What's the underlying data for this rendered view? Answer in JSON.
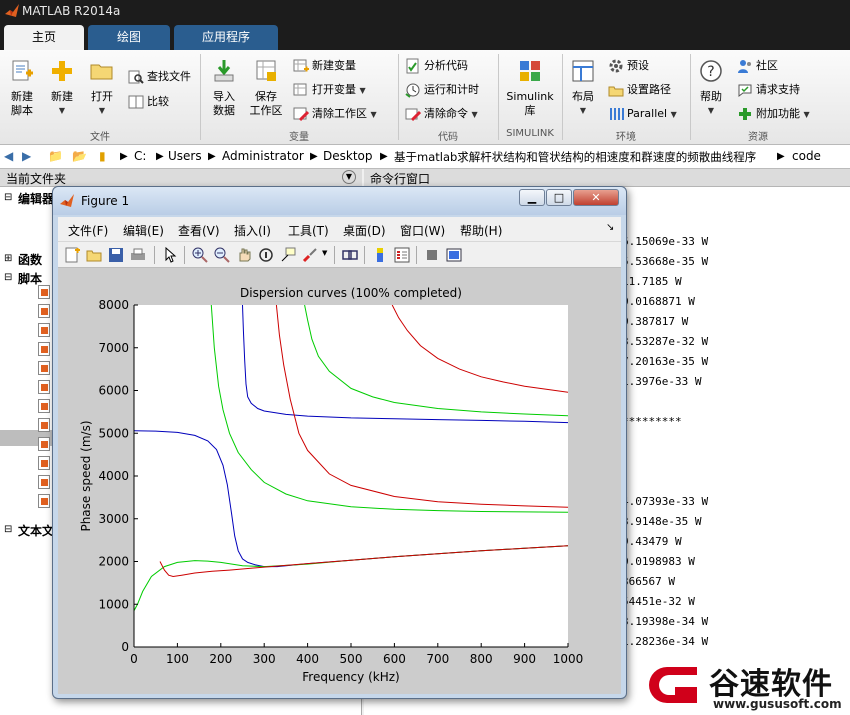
{
  "app": {
    "title": "MATLAB R2014a"
  },
  "tabs": [
    {
      "label": "主页"
    },
    {
      "label": "绘图"
    },
    {
      "label": "应用程序"
    }
  ],
  "ribbon": {
    "file": {
      "new_script": "新建\n脚本",
      "new": "新建",
      "open": "打开",
      "find_files": "查找文件",
      "compare": "比较",
      "group": "文件"
    },
    "variable": {
      "import": "导入\n数据",
      "save_ws": "保存\n工作区",
      "new_var": "新建变量",
      "open_var": "打开变量",
      "clear_ws": "清除工作区",
      "group": "变量"
    },
    "code": {
      "analyze": "分析代码",
      "run_time": "运行和计时",
      "clear_cmd": "清除命令",
      "group": "代码"
    },
    "simulink": {
      "lib": "Simulink\n库",
      "group": "SIMULINK"
    },
    "env": {
      "layout": "布局",
      "prefs": "预设",
      "set_path": "设置路径",
      "parallel": "Parallel",
      "group": "环境"
    },
    "resources": {
      "help": "帮助",
      "community": "社区",
      "support": "请求支持",
      "addons": "附加功能",
      "group": "资源"
    }
  },
  "address": {
    "crumbs": [
      "C:",
      "Users",
      "Administrator",
      "Desktop",
      "基于matlab求解杆状结构和管状结构的相速度和群速度的频散曲线程序",
      "code"
    ]
  },
  "panels": {
    "current_folder": "当前文件夹",
    "command_window": "命令行窗口",
    "left_items": {
      "editor": "编辑器",
      "functions": "函数",
      "scripts": "脚本",
      "text_files": "文本文"
    }
  },
  "command_lines": [
    "6.15069e-33 W",
    "5.53668e-35 W",
    "11.7185 W",
    "0.0168871 W",
    "0.387817 W",
    "3.53287e-32 W",
    "7.20163e-35 W",
    "1.3976e-33 W",
    "*********",
    "4.07393e-33 W",
    "3.9148e-35 W",
    "9.43479 W",
    "0.0198983 W",
    "366567 W",
    "54451e-32 W",
    "3.19398e-34 W",
    "1.28236e-34 W"
  ],
  "figure": {
    "title": "Figure 1",
    "menu": [
      "文件(F)",
      "编辑(E)",
      "查看(V)",
      "插入(I)",
      "工具(T)",
      "桌面(D)",
      "窗口(W)",
      "帮助(H)"
    ]
  },
  "watermark": {
    "brand": "谷速软件",
    "url": "www.gususoft.com"
  },
  "colors": {
    "red": "#cc0000",
    "green": "#00cc00",
    "blue": "#0000bb"
  },
  "chart_data": {
    "type": "line",
    "title": "Dispersion curves (100% completed)",
    "xlabel": "Frequency (kHz)",
    "ylabel": "Phase speed (m/s)",
    "xlim": [
      0,
      1000
    ],
    "ylim": [
      0,
      8000
    ],
    "xticks": [
      0,
      100,
      200,
      300,
      400,
      500,
      600,
      700,
      800,
      900,
      1000
    ],
    "yticks": [
      0,
      1000,
      2000,
      3000,
      4000,
      5000,
      6000,
      7000,
      8000
    ],
    "grid": false,
    "series": [
      {
        "color": "#0000bb",
        "x": [
          0,
          50,
          100,
          140,
          170,
          190,
          205,
          215,
          225,
          232,
          240,
          250,
          262,
          280,
          300,
          330,
          400,
          500,
          600,
          700,
          800,
          900,
          1000
        ],
        "y": [
          5060,
          5050,
          5020,
          4950,
          4820,
          4620,
          4250,
          3800,
          3100,
          2600,
          2250,
          2060,
          1980,
          1920,
          1880,
          1880,
          1950,
          2030,
          2110,
          2180,
          2250,
          2310,
          2370
        ]
      },
      {
        "color": "#0000bb",
        "x": [
          250,
          252,
          255,
          258,
          262,
          270,
          285,
          300,
          350,
          400,
          500,
          600,
          700,
          800,
          900,
          1000
        ],
        "y": [
          8000,
          7400,
          6700,
          6150,
          5850,
          5700,
          5580,
          5520,
          5440,
          5400,
          5360,
          5340,
          5320,
          5300,
          5280,
          5250
        ]
      },
      {
        "color": "#00cc00",
        "x": [
          0,
          8,
          20,
          40,
          70,
          100,
          140,
          170,
          200,
          250,
          300,
          400,
          500,
          600,
          700,
          800,
          900,
          1000
        ],
        "y": [
          850,
          1000,
          1300,
          1650,
          1880,
          1980,
          2020,
          2010,
          1980,
          1900,
          1880,
          1940,
          2030,
          2110,
          2180,
          2250,
          2310,
          2370
        ]
      },
      {
        "color": "#00cc00",
        "x": [
          178,
          185,
          195,
          205,
          220,
          240,
          270,
          300,
          350,
          400,
          500,
          600,
          700,
          800,
          900,
          1000
        ],
        "y": [
          8000,
          7000,
          6100,
          5550,
          5000,
          4550,
          4150,
          3850,
          3580,
          3420,
          3280,
          3220,
          3190,
          3170,
          3160,
          3150
        ]
      },
      {
        "color": "#00cc00",
        "x": [
          393,
          400,
          410,
          425,
          450,
          500,
          550,
          600,
          700,
          800,
          900,
          1000
        ],
        "y": [
          8000,
          7650,
          7200,
          6800,
          6450,
          6050,
          5850,
          5720,
          5580,
          5500,
          5450,
          5410
        ]
      },
      {
        "color": "#cc0000",
        "x": [
          60,
          70,
          80,
          90,
          110,
          140,
          180,
          220,
          300,
          400,
          500,
          600,
          700,
          800,
          900,
          1000
        ],
        "y": [
          2000,
          1800,
          1680,
          1650,
          1680,
          1730,
          1770,
          1800,
          1870,
          1950,
          2030,
          2110,
          2180,
          2250,
          2310,
          2370
        ]
      },
      {
        "color": "#cc0000",
        "x": [
          328,
          335,
          345,
          360,
          380,
          400,
          450,
          500,
          600,
          700,
          800,
          900,
          1000
        ],
        "y": [
          8000,
          7300,
          6600,
          5800,
          5000,
          4600,
          4050,
          3780,
          3520,
          3400,
          3340,
          3300,
          3270
        ]
      },
      {
        "color": "#cc0000",
        "x": [
          595,
          610,
          630,
          660,
          700,
          750,
          800,
          850,
          900,
          950,
          1000
        ],
        "y": [
          8000,
          7700,
          7400,
          7050,
          6750,
          6500,
          6320,
          6200,
          6100,
          6030,
          5960
        ]
      }
    ]
  }
}
